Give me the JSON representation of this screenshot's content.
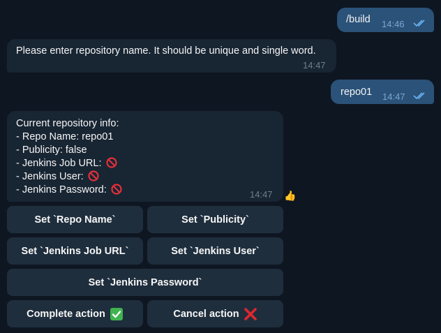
{
  "messages": {
    "m1": {
      "text": "/build",
      "time": "14:46"
    },
    "m2": {
      "text": "Please enter repository name. It should be unique and single word.",
      "time": "14:47"
    },
    "m3": {
      "text": "repo01",
      "time": "14:47"
    },
    "m4": {
      "lines": [
        "Current repository info:",
        "- Repo Name: repo01",
        "- Publicity: false",
        "- Jenkins Job URL:",
        "- Jenkins User:",
        "- Jenkins Password:"
      ],
      "time": "14:47",
      "reaction": "👍"
    }
  },
  "keyboard": {
    "set_repo_name": "Set `Repo Name`",
    "set_publicity": "Set `Publicity`",
    "set_jenkins_job_url": "Set `Jenkins Job URL`",
    "set_jenkins_user": "Set `Jenkins User`",
    "set_jenkins_password": "Set `Jenkins Password`",
    "complete_action": "Complete action",
    "cancel_action": "Cancel action"
  },
  "icons": {
    "no_entry": "prohibited-icon",
    "check": "check-mark-icon",
    "cross": "cross-mark-icon",
    "read": "double-check-icon"
  },
  "colors": {
    "background": "#0e1621",
    "outgoing_bubble": "#2b5278",
    "incoming_bubble": "#182533",
    "keyboard_button": "#1f2e3d",
    "read_check": "#6ab2f2"
  }
}
